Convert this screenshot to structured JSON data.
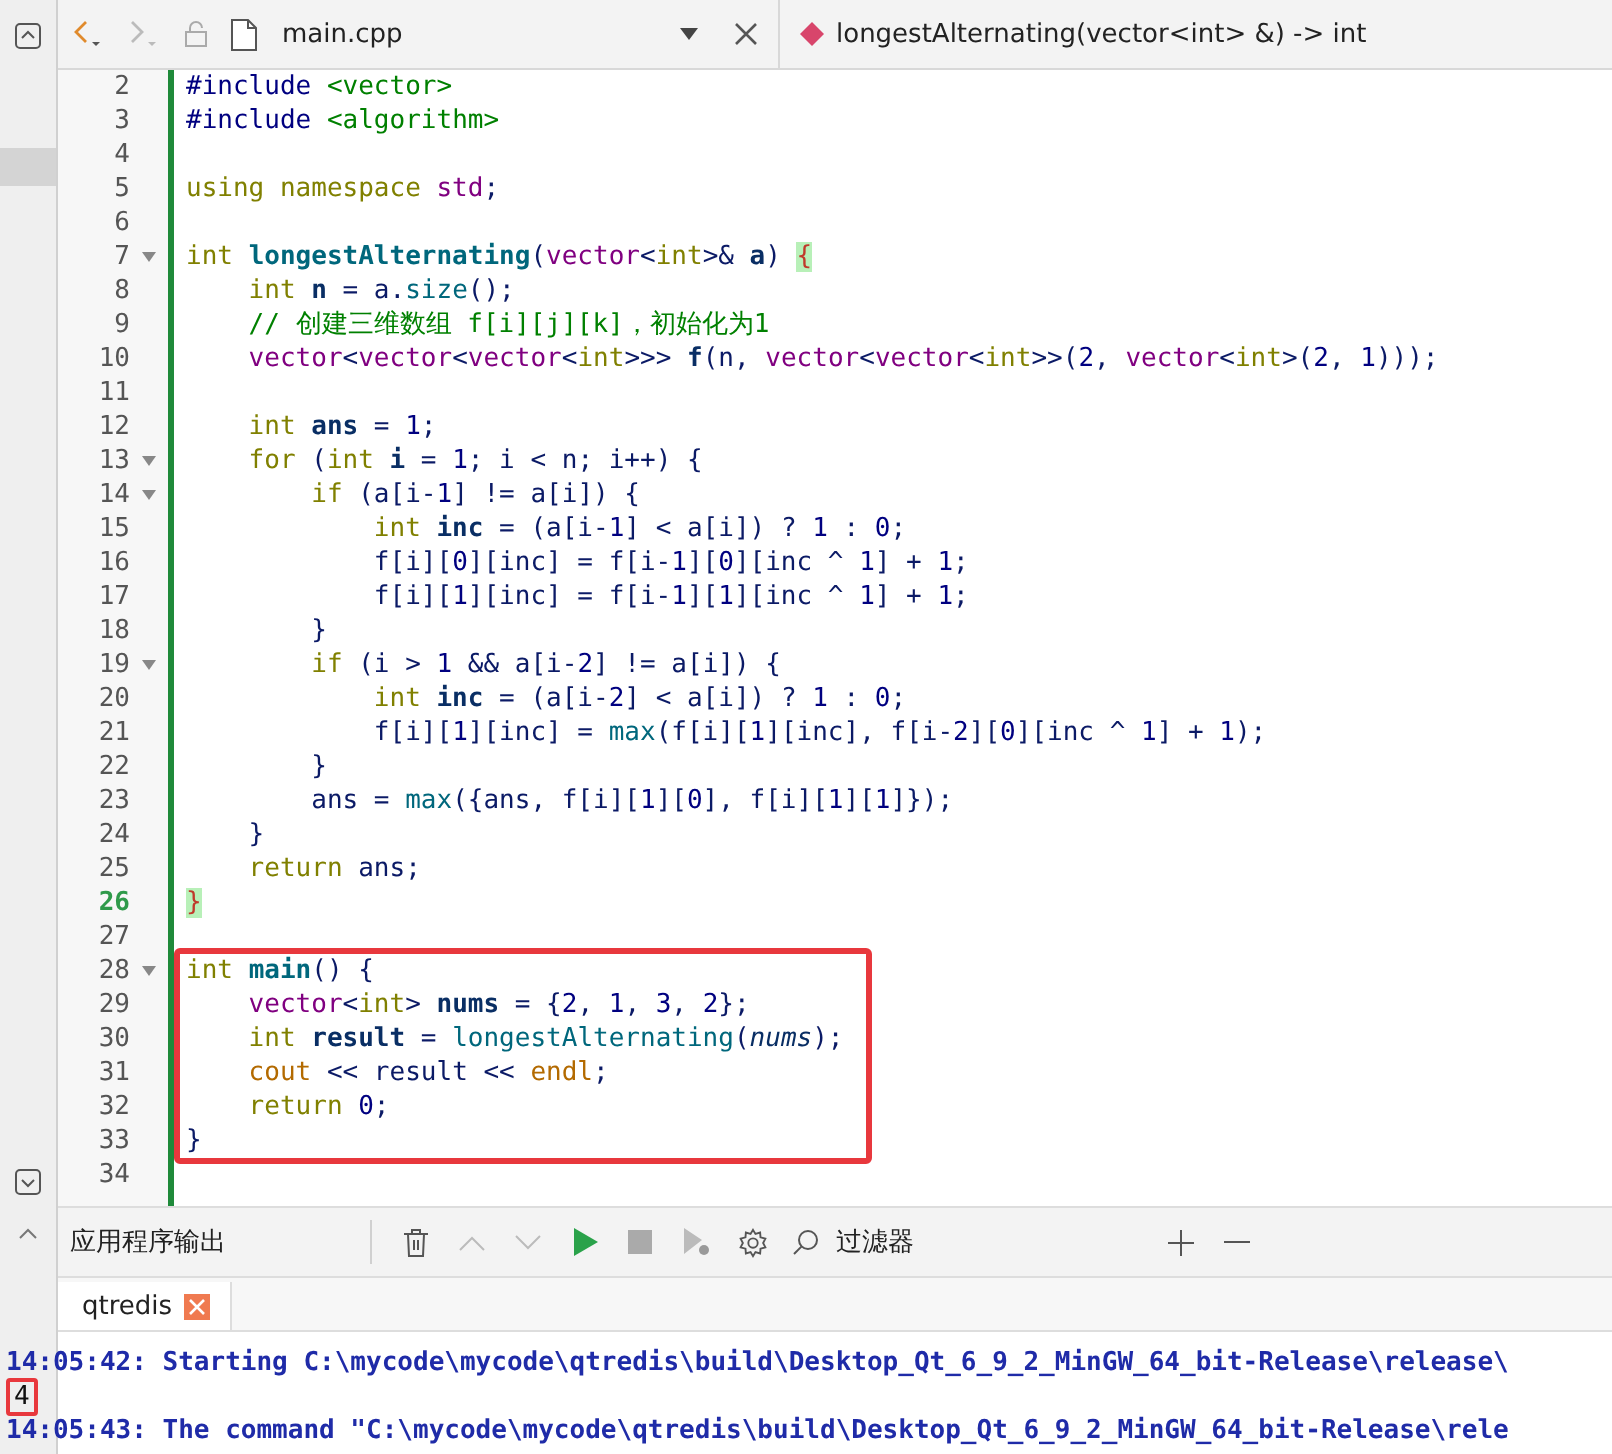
{
  "toolbar": {
    "nav": [
      {
        "kind": "back",
        "disabled": false
      },
      {
        "kind": "forward",
        "disabled": true
      }
    ],
    "file": "main.cpp",
    "symbol": "longestAlternating(vector<int> &) -> int"
  },
  "editor": {
    "lines": [
      {
        "n": "2",
        "fold": false,
        "current": false,
        "boxed": false,
        "tokens": [
          {
            "kind": "inc",
            "text": "#include "
          },
          {
            "kind": "hdr",
            "text": "<vector>"
          }
        ]
      },
      {
        "n": "3",
        "fold": false,
        "current": false,
        "boxed": false,
        "tokens": [
          {
            "kind": "inc",
            "text": "#include "
          },
          {
            "kind": "hdr",
            "text": "<algorithm>"
          }
        ]
      },
      {
        "n": "4",
        "fold": false,
        "current": false,
        "boxed": false
      },
      {
        "n": "5",
        "fold": false,
        "current": false,
        "boxed": false,
        "tokens": [
          {
            "kind": "kw",
            "text": "using namespace "
          },
          {
            "kind": "ty",
            "text": "std"
          },
          {
            "kind": "p",
            "text": ";"
          }
        ]
      },
      {
        "n": "6",
        "fold": false,
        "current": false,
        "boxed": false
      },
      {
        "n": "7",
        "fold": true,
        "current": false,
        "boxed": false,
        "tokens": [
          {
            "kind": "kw",
            "text": "int "
          },
          {
            "kind": "fn",
            "text": "longestAlternating"
          },
          {
            "kind": "p",
            "text": "("
          },
          {
            "kind": "ty",
            "text": "vector"
          },
          {
            "kind": "p",
            "text": "<"
          },
          {
            "kind": "kw",
            "text": "int"
          },
          {
            "kind": "p",
            "text": ">& "
          },
          {
            "kind": "var",
            "text": "a"
          },
          {
            "kind": "p",
            "text": ") "
          },
          {
            "kind": "bm",
            "text": "{"
          }
        ]
      },
      {
        "n": "8",
        "fold": false,
        "current": false,
        "boxed": false,
        "tokens": [
          {
            "kind": "kw",
            "text": "    int "
          },
          {
            "kind": "var",
            "text": "n"
          },
          {
            "kind": "p",
            "text": " = a."
          },
          {
            "kind": "call",
            "text": "size"
          },
          {
            "kind": "p",
            "text": "();"
          }
        ]
      },
      {
        "n": "9",
        "fold": false,
        "current": false,
        "boxed": false,
        "tokens": [
          {
            "kind": "cm",
            "text": "    // 创建三维数组 f[i][j][k]，初始化为1"
          }
        ]
      },
      {
        "n": "10",
        "fold": false,
        "current": false,
        "boxed": false,
        "tokens": [
          {
            "kind": "ty",
            "text": "    vector"
          },
          {
            "kind": "p",
            "text": "<"
          },
          {
            "kind": "ty",
            "text": "vector"
          },
          {
            "kind": "p",
            "text": "<"
          },
          {
            "kind": "ty",
            "text": "vector"
          },
          {
            "kind": "p",
            "text": "<"
          },
          {
            "kind": "kw",
            "text": "int"
          },
          {
            "kind": "p",
            "text": ">>> "
          },
          {
            "kind": "var",
            "text": "f"
          },
          {
            "kind": "p",
            "text": "(n, "
          },
          {
            "kind": "ty",
            "text": "vector"
          },
          {
            "kind": "p",
            "text": "<"
          },
          {
            "kind": "ty",
            "text": "vector"
          },
          {
            "kind": "p",
            "text": "<"
          },
          {
            "kind": "kw",
            "text": "int"
          },
          {
            "kind": "p",
            "text": ">>("
          },
          {
            "kind": "num",
            "text": "2"
          },
          {
            "kind": "p",
            "text": ", "
          },
          {
            "kind": "ty",
            "text": "vector"
          },
          {
            "kind": "p",
            "text": "<"
          },
          {
            "kind": "kw",
            "text": "int"
          },
          {
            "kind": "p",
            "text": ">("
          },
          {
            "kind": "num",
            "text": "2"
          },
          {
            "kind": "p",
            "text": ", "
          },
          {
            "kind": "num",
            "text": "1"
          },
          {
            "kind": "p",
            "text": ")));"
          }
        ]
      },
      {
        "n": "11",
        "fold": false,
        "current": false,
        "boxed": false
      },
      {
        "n": "12",
        "fold": false,
        "current": false,
        "boxed": false,
        "tokens": [
          {
            "kind": "kw",
            "text": "    int "
          },
          {
            "kind": "var",
            "text": "ans"
          },
          {
            "kind": "p",
            "text": " = "
          },
          {
            "kind": "num",
            "text": "1"
          },
          {
            "kind": "p",
            "text": ";"
          }
        ]
      },
      {
        "n": "13",
        "fold": true,
        "current": false,
        "boxed": false,
        "tokens": [
          {
            "kind": "kw",
            "text": "    for"
          },
          {
            "kind": "p",
            "text": " ("
          },
          {
            "kind": "kw",
            "text": "int "
          },
          {
            "kind": "var",
            "text": "i"
          },
          {
            "kind": "p",
            "text": " = "
          },
          {
            "kind": "num",
            "text": "1"
          },
          {
            "kind": "p",
            "text": "; i < n; i++) {"
          }
        ]
      },
      {
        "n": "14",
        "fold": true,
        "current": false,
        "boxed": false,
        "tokens": [
          {
            "kind": "kw",
            "text": "        if"
          },
          {
            "kind": "p",
            "text": " (a[i-"
          },
          {
            "kind": "num",
            "text": "1"
          },
          {
            "kind": "p",
            "text": "] != a[i]) {"
          }
        ]
      },
      {
        "n": "15",
        "fold": false,
        "current": false,
        "boxed": false,
        "tokens": [
          {
            "kind": "kw",
            "text": "            int "
          },
          {
            "kind": "var",
            "text": "inc"
          },
          {
            "kind": "p",
            "text": " = (a[i-"
          },
          {
            "kind": "num",
            "text": "1"
          },
          {
            "kind": "p",
            "text": "] < a[i]) ? "
          },
          {
            "kind": "num",
            "text": "1"
          },
          {
            "kind": "p",
            "text": " : "
          },
          {
            "kind": "num",
            "text": "0"
          },
          {
            "kind": "p",
            "text": ";"
          }
        ]
      },
      {
        "n": "16",
        "fold": false,
        "current": false,
        "boxed": false,
        "tokens": [
          {
            "kind": "p",
            "text": "            f[i]["
          },
          {
            "kind": "num",
            "text": "0"
          },
          {
            "kind": "p",
            "text": "][inc] = f[i-"
          },
          {
            "kind": "num",
            "text": "1"
          },
          {
            "kind": "p",
            "text": "]["
          },
          {
            "kind": "num",
            "text": "0"
          },
          {
            "kind": "p",
            "text": "][inc ^ "
          },
          {
            "kind": "num",
            "text": "1"
          },
          {
            "kind": "p",
            "text": "] + "
          },
          {
            "kind": "num",
            "text": "1"
          },
          {
            "kind": "p",
            "text": ";"
          }
        ]
      },
      {
        "n": "17",
        "fold": false,
        "current": false,
        "boxed": false,
        "tokens": [
          {
            "kind": "p",
            "text": "            f[i]["
          },
          {
            "kind": "num",
            "text": "1"
          },
          {
            "kind": "p",
            "text": "][inc] = f[i-"
          },
          {
            "kind": "num",
            "text": "1"
          },
          {
            "kind": "p",
            "text": "]["
          },
          {
            "kind": "num",
            "text": "1"
          },
          {
            "kind": "p",
            "text": "][inc ^ "
          },
          {
            "kind": "num",
            "text": "1"
          },
          {
            "kind": "p",
            "text": "] + "
          },
          {
            "kind": "num",
            "text": "1"
          },
          {
            "kind": "p",
            "text": ";"
          }
        ]
      },
      {
        "n": "18",
        "fold": false,
        "current": false,
        "boxed": false,
        "tokens": [
          {
            "kind": "p",
            "text": "        }"
          }
        ]
      },
      {
        "n": "19",
        "fold": true,
        "current": false,
        "boxed": false,
        "tokens": [
          {
            "kind": "kw",
            "text": "        if"
          },
          {
            "kind": "p",
            "text": " (i > "
          },
          {
            "kind": "num",
            "text": "1"
          },
          {
            "kind": "p",
            "text": " && a[i-"
          },
          {
            "kind": "num",
            "text": "2"
          },
          {
            "kind": "p",
            "text": "] != a[i]) {"
          }
        ]
      },
      {
        "n": "20",
        "fold": false,
        "current": false,
        "boxed": false,
        "tokens": [
          {
            "kind": "kw",
            "text": "            int "
          },
          {
            "kind": "var",
            "text": "inc"
          },
          {
            "kind": "p",
            "text": " = (a[i-"
          },
          {
            "kind": "num",
            "text": "2"
          },
          {
            "kind": "p",
            "text": "] < a[i]) ? "
          },
          {
            "kind": "num",
            "text": "1"
          },
          {
            "kind": "p",
            "text": " : "
          },
          {
            "kind": "num",
            "text": "0"
          },
          {
            "kind": "p",
            "text": ";"
          }
        ]
      },
      {
        "n": "21",
        "fold": false,
        "current": false,
        "boxed": false,
        "tokens": [
          {
            "kind": "p",
            "text": "            f[i]["
          },
          {
            "kind": "num",
            "text": "1"
          },
          {
            "kind": "p",
            "text": "][inc] = "
          },
          {
            "kind": "call",
            "text": "max"
          },
          {
            "kind": "p",
            "text": "(f[i]["
          },
          {
            "kind": "num",
            "text": "1"
          },
          {
            "kind": "p",
            "text": "][inc], f[i-"
          },
          {
            "kind": "num",
            "text": "2"
          },
          {
            "kind": "p",
            "text": "]["
          },
          {
            "kind": "num",
            "text": "0"
          },
          {
            "kind": "p",
            "text": "][inc ^ "
          },
          {
            "kind": "num",
            "text": "1"
          },
          {
            "kind": "p",
            "text": "] + "
          },
          {
            "kind": "num",
            "text": "1"
          },
          {
            "kind": "p",
            "text": ");"
          }
        ]
      },
      {
        "n": "22",
        "fold": false,
        "current": false,
        "boxed": false,
        "tokens": [
          {
            "kind": "p",
            "text": "        }"
          }
        ]
      },
      {
        "n": "23",
        "fold": false,
        "current": false,
        "boxed": false,
        "tokens": [
          {
            "kind": "p",
            "text": "        ans = "
          },
          {
            "kind": "call",
            "text": "max"
          },
          {
            "kind": "p",
            "text": "({ans, f[i]["
          },
          {
            "kind": "num",
            "text": "1"
          },
          {
            "kind": "p",
            "text": "]["
          },
          {
            "kind": "num",
            "text": "0"
          },
          {
            "kind": "p",
            "text": "], f[i]["
          },
          {
            "kind": "num",
            "text": "1"
          },
          {
            "kind": "p",
            "text": "]["
          },
          {
            "kind": "num",
            "text": "1"
          },
          {
            "kind": "p",
            "text": "]});"
          }
        ]
      },
      {
        "n": "24",
        "fold": false,
        "current": false,
        "boxed": false,
        "tokens": [
          {
            "kind": "p",
            "text": "    }"
          }
        ]
      },
      {
        "n": "25",
        "fold": false,
        "current": false,
        "boxed": false,
        "tokens": [
          {
            "kind": "kw",
            "text": "    return"
          },
          {
            "kind": "p",
            "text": " ans;"
          }
        ]
      },
      {
        "n": "26",
        "fold": false,
        "current": true,
        "boxed": false,
        "tokens": [
          {
            "kind": "bm",
            "text": "}"
          }
        ]
      },
      {
        "n": "27",
        "fold": false,
        "current": false,
        "boxed": false
      },
      {
        "n": "28",
        "fold": true,
        "current": false,
        "boxed": true,
        "tokens": [
          {
            "kind": "kw",
            "text": "int "
          },
          {
            "kind": "fn",
            "text": "main"
          },
          {
            "kind": "p",
            "text": "() {"
          }
        ]
      },
      {
        "n": "29",
        "fold": false,
        "current": false,
        "boxed": true,
        "tokens": [
          {
            "kind": "ty",
            "text": "    vector"
          },
          {
            "kind": "p",
            "text": "<"
          },
          {
            "kind": "kw",
            "text": "int"
          },
          {
            "kind": "p",
            "text": "> "
          },
          {
            "kind": "var",
            "text": "nums"
          },
          {
            "kind": "p",
            "text": " = {"
          },
          {
            "kind": "num",
            "text": "2"
          },
          {
            "kind": "p",
            "text": ", "
          },
          {
            "kind": "num",
            "text": "1"
          },
          {
            "kind": "p",
            "text": ", "
          },
          {
            "kind": "num",
            "text": "3"
          },
          {
            "kind": "p",
            "text": ", "
          },
          {
            "kind": "num",
            "text": "2"
          },
          {
            "kind": "p",
            "text": "};"
          }
        ]
      },
      {
        "n": "30",
        "fold": false,
        "current": false,
        "boxed": true,
        "tokens": [
          {
            "kind": "kw",
            "text": "    int "
          },
          {
            "kind": "var",
            "text": "result"
          },
          {
            "kind": "p",
            "text": " = "
          },
          {
            "kind": "call",
            "text": "longestAlternating"
          },
          {
            "kind": "p",
            "text": "("
          },
          {
            "kind": "it",
            "text": "nums"
          },
          {
            "kind": "p",
            "text": ");"
          }
        ]
      },
      {
        "n": "31",
        "fold": false,
        "current": false,
        "boxed": true,
        "tokens": [
          {
            "kind": "lib",
            "text": "    cout"
          },
          {
            "kind": "p",
            "text": " << result << "
          },
          {
            "kind": "lib",
            "text": "endl"
          },
          {
            "kind": "p",
            "text": ";"
          }
        ]
      },
      {
        "n": "32",
        "fold": false,
        "current": false,
        "boxed": true,
        "tokens": [
          {
            "kind": "kw",
            "text": "    return "
          },
          {
            "kind": "num",
            "text": "0"
          },
          {
            "kind": "p",
            "text": ";"
          }
        ]
      },
      {
        "n": "33",
        "fold": false,
        "current": false,
        "boxed": true,
        "tokens": [
          {
            "kind": "p",
            "text": "}"
          }
        ]
      },
      {
        "n": "34",
        "fold": false,
        "current": false,
        "boxed": false
      }
    ]
  },
  "output_pane": {
    "title": "应用程序输出",
    "tools": [
      {
        "kind": "trash",
        "disabled": false
      },
      {
        "kind": "up",
        "disabled": true
      },
      {
        "kind": "down",
        "disabled": true
      },
      {
        "kind": "run",
        "disabled": false
      },
      {
        "kind": "stop",
        "disabled": true
      },
      {
        "kind": "debug",
        "disabled": true
      },
      {
        "kind": "settings",
        "disabled": false
      }
    ],
    "filter": {
      "placeholder": "过滤器"
    },
    "zoom": [
      {
        "kind": "plus"
      },
      {
        "kind": "minus"
      }
    ],
    "tabs": [
      {
        "label": "qtredis",
        "selected": true
      }
    ],
    "lines": [
      {
        "kind": "sys",
        "text": "14:05:42: Starting C:\\mycode\\mycode\\qtredis\\build\\Desktop_Qt_6_9_2_MinGW_64_bit-Release\\release\\",
        "boxed": false
      },
      {
        "kind": "stdout",
        "text": "4",
        "boxed": true
      },
      {
        "kind": "sys",
        "text": "14:05:43: The command \"C:\\mycode\\mycode\\qtredis\\build\\Desktop_Qt_6_9_2_MinGW_64_bit-Release\\rele",
        "boxed": false
      }
    ]
  }
}
